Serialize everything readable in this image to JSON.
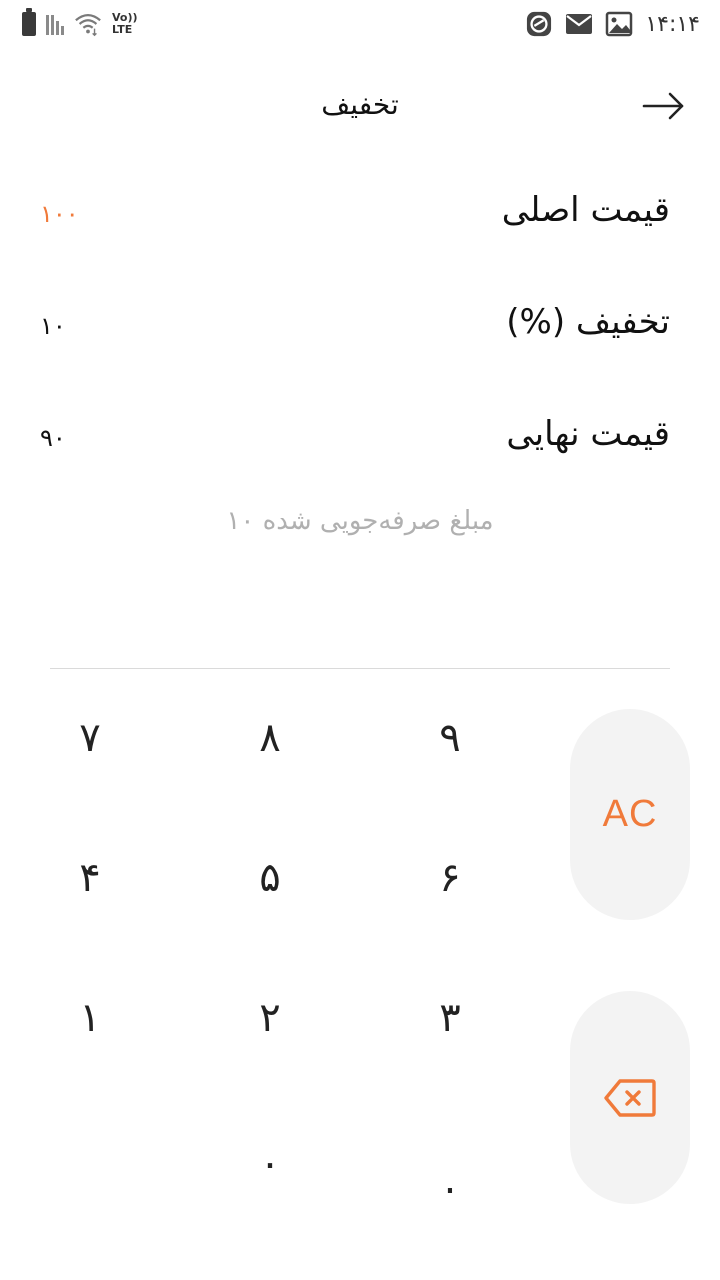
{
  "status_bar": {
    "time": "۱۴:۱۴",
    "network_label_top": "Vo))",
    "network_label_bottom": "LTE",
    "icons": [
      "battery-icon",
      "signal-icon",
      "wifi-icon",
      "app-icon",
      "mail-icon",
      "image-icon"
    ]
  },
  "header": {
    "title": "تخفیف",
    "back_icon": "arrow-right-icon"
  },
  "rows": {
    "original_price": {
      "label": "قیمت اصلی",
      "value": "۱۰۰"
    },
    "discount": {
      "label": "تخفیف (%)",
      "value": "۱۰"
    },
    "final_price": {
      "label": "قیمت نهایی",
      "value": "۹۰"
    }
  },
  "savings_text": "مبلغ صرفه‌جویی شده  ۱۰",
  "keypad": {
    "k7": "۷",
    "k8": "۸",
    "k9": "۹",
    "k4": "۴",
    "k5": "۵",
    "k6": "۶",
    "k1": "۱",
    "k2": "۲",
    "k3": "۳",
    "k0": "۰",
    "kdot": ".",
    "clear_label": "AC",
    "delete_icon": "backspace-icon"
  },
  "colors": {
    "accent": "#f07a3a",
    "text": "#111111",
    "muted": "#b0b0b0",
    "key_bg": "#f3f3f3",
    "divider": "#dadada"
  }
}
